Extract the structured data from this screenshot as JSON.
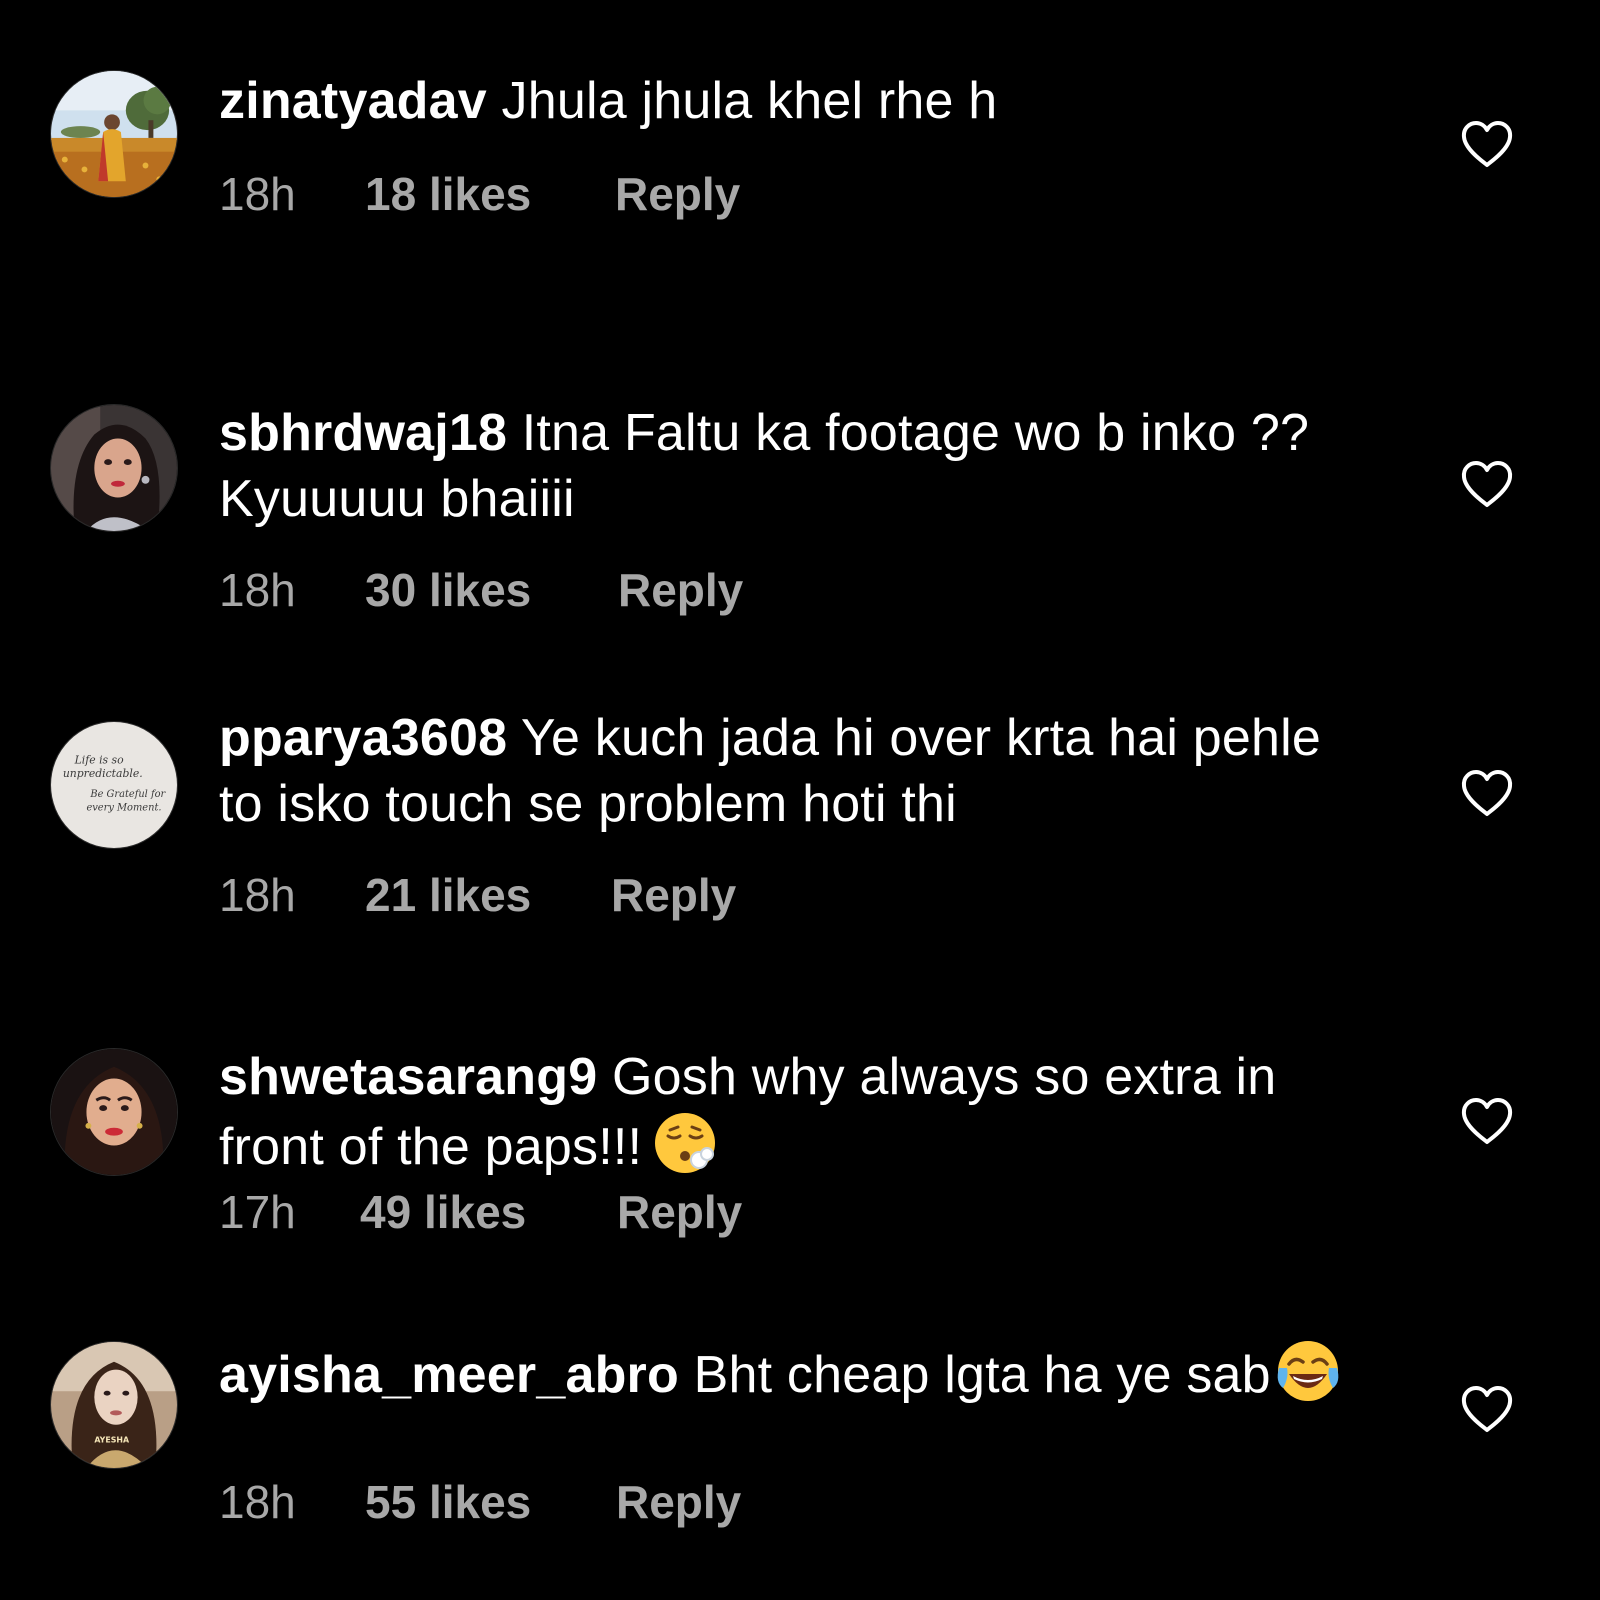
{
  "colors": {
    "background": "#000000",
    "text": "#ffffff",
    "meta": "#a8a8a8"
  },
  "comments": [
    {
      "username": "zinatyadav",
      "text": "Jhula jhula khel rhe h",
      "time": "18h",
      "likes": "18 likes",
      "reply": "Reply",
      "avatar_icon": "avatar-flower-field-photo",
      "like_icon": "heart-outline-icon"
    },
    {
      "username": "sbhrdwaj18",
      "text": "Itna Faltu ka footage wo b inko ?? Kyuuuuu bhaiiii",
      "time": "18h",
      "likes": "30 likes",
      "reply": "Reply",
      "avatar_icon": "avatar-portrait-photo",
      "like_icon": "heart-outline-icon"
    },
    {
      "username": "pparya3608",
      "text": "Ye kuch jada hi over krta hai pehle to isko touch se problem hoti thi",
      "time": "18h",
      "likes": "21 likes",
      "reply": "Reply",
      "avatar_icon": "avatar-quote-card",
      "avatar_text": [
        "Life is so",
        "unpredictable.",
        "Be Grateful for",
        "every Moment."
      ],
      "like_icon": "heart-outline-icon"
    },
    {
      "username": "shwetasarang9",
      "text": "Gosh why always so extra in front of the paps!!!",
      "emoji": "face-exhaling-emoji",
      "time": "17h",
      "likes": "49 likes",
      "reply": "Reply",
      "avatar_icon": "avatar-portrait-photo",
      "like_icon": "heart-outline-icon"
    },
    {
      "username": "ayisha_meer_abro",
      "text": "Bht cheap lgta ha ye sab",
      "emoji": "face-with-tears-of-joy-emoji",
      "time": "18h",
      "likes": "55 likes",
      "reply": "Reply",
      "avatar_icon": "avatar-portrait-photo",
      "avatar_text": [
        "AYESHA"
      ],
      "like_icon": "heart-outline-icon"
    }
  ]
}
